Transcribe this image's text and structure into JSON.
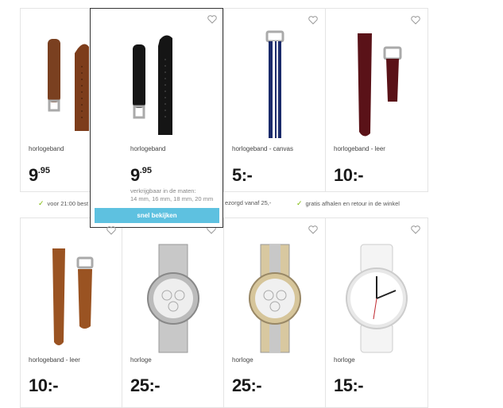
{
  "products": [
    {
      "name": "horlogeband",
      "price_main": "9",
      "price_cents": ".95",
      "image": "brown-leather-strap"
    },
    {
      "name": "horlogeband",
      "price_main": "9",
      "price_cents": ".95",
      "image": "black-leather-strap"
    },
    {
      "name": "horlogeband - canvas",
      "price_main": "5:-",
      "price_cents": "",
      "image": "navy-white-canvas-strap"
    },
    {
      "name": "horlogeband - leer",
      "price_main": "10:-",
      "price_cents": "",
      "image": "burgundy-leather-strap"
    },
    {
      "name": "horlogeband - leer",
      "price_main": "10:-",
      "price_cents": "",
      "image": "cognac-croco-strap"
    },
    {
      "name": "horloge",
      "price_main": "25:-",
      "price_cents": "",
      "image": "silver-chronograph-watch"
    },
    {
      "name": "horloge",
      "price_main": "25:-",
      "price_cents": "",
      "image": "gold-silver-chronograph-watch"
    },
    {
      "name": "horloge",
      "price_main": "15:-",
      "price_cents": "",
      "image": "white-leather-watch"
    }
  ],
  "hover_card": {
    "name": "horlogeband",
    "price_main": "9",
    "price_cents": ".95",
    "sizes_line1": "verkrijgbaar in de maten:",
    "sizes_line2": "14 mm, 16 mm, 18 mm, 20 mm",
    "quick_view_label": "snel bekijken"
  },
  "usp": {
    "item1": "voor 21:00 best",
    "item2": "ezorgd vanaf 25,-",
    "item3": "gratis afhalen en retour in de winkel"
  },
  "colors": {
    "accent_button": "#5ec1e0",
    "check": "#7ab800"
  }
}
